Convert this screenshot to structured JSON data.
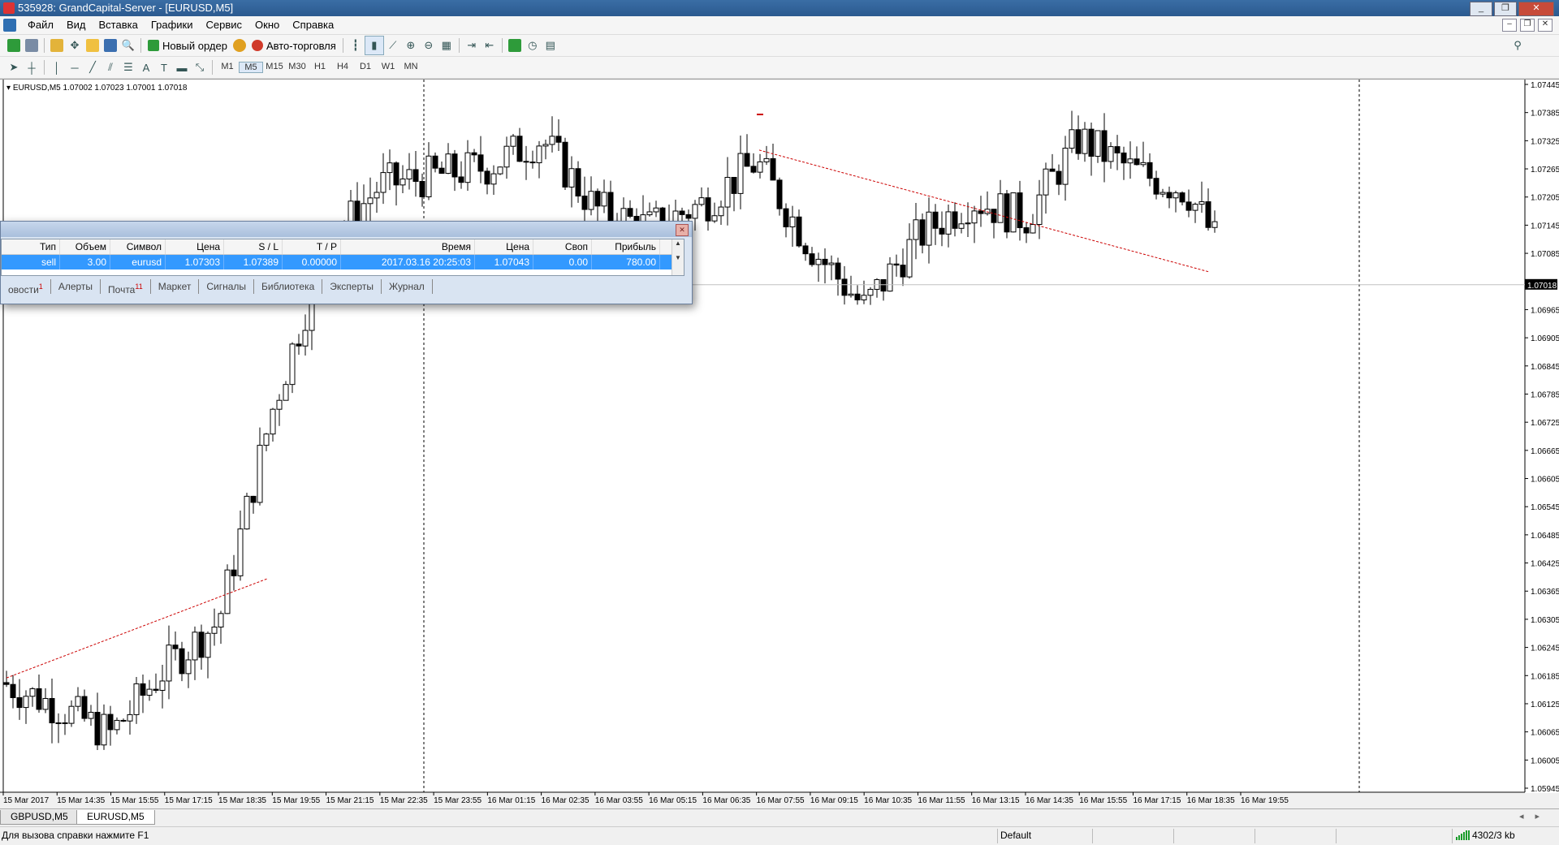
{
  "window": {
    "title": "535928: GrandCapital-Server - [EURUSD,M5]"
  },
  "menu": {
    "items": [
      "Файл",
      "Вид",
      "Вставка",
      "Графики",
      "Сервис",
      "Окно",
      "Справка"
    ]
  },
  "toolbar": {
    "new_order": "Новый ордер",
    "auto_trading": "Авто-торговля"
  },
  "timeframes": [
    "M1",
    "M5",
    "M15",
    "M30",
    "H1",
    "H4",
    "D1",
    "W1",
    "MN"
  ],
  "chart": {
    "header": "EURUSD,M5  1.07002 1.07023 1.07001 1.07018",
    "current_price": "1.07018",
    "price_labels": [
      "1.07445",
      "1.07385",
      "1.07325",
      "1.07265",
      "1.07205",
      "1.07145",
      "1.07085",
      "1.06965",
      "1.06905",
      "1.06845",
      "1.06785",
      "1.06725",
      "1.06665",
      "1.06605",
      "1.06545",
      "1.06485",
      "1.06425",
      "1.06365",
      "1.06305",
      "1.06245",
      "1.06185",
      "1.06125",
      "1.06065",
      "1.06005",
      "1.05945"
    ],
    "time_labels": [
      "15 Mar 2017",
      "15 Mar 14:35",
      "15 Mar 15:55",
      "15 Mar 17:15",
      "15 Mar 18:35",
      "15 Mar 19:55",
      "15 Mar 21:15",
      "15 Mar 22:35",
      "15 Mar 23:55",
      "16 Mar 01:15",
      "16 Mar 02:35",
      "16 Mar 03:55",
      "16 Mar 05:15",
      "16 Mar 06:35",
      "16 Mar 07:55",
      "16 Mar 09:15",
      "16 Mar 10:35",
      "16 Mar 11:55",
      "16 Mar 13:15",
      "16 Mar 14:35",
      "16 Mar 15:55",
      "16 Mar 17:15",
      "16 Mar 18:35",
      "16 Mar 19:55"
    ]
  },
  "chart_data": {
    "type": "candlestick",
    "symbol": "EURUSD",
    "timeframe": "M5",
    "ylim": [
      1.05945,
      1.07445
    ],
    "last": {
      "open": 1.07002,
      "high": 1.07023,
      "low": 1.07001,
      "close": 1.07018
    },
    "close_path": [
      [
        "15 Mar 2017",
        1.0617
      ],
      [
        "15 Mar 14:35",
        1.0612
      ],
      [
        "15 Mar 15:55",
        1.0606
      ],
      [
        "15 Mar 17:15",
        1.062
      ],
      [
        "15 Mar 18:35",
        1.063
      ],
      [
        "15 Mar 19:55",
        1.0675
      ],
      [
        "15 Mar 21:15",
        1.071
      ],
      [
        "15 Mar 22:35",
        1.0723
      ],
      [
        "15 Mar 23:55",
        1.0725
      ],
      [
        "16 Mar 01:15",
        1.0727
      ],
      [
        "16 Mar 02:35",
        1.0733
      ],
      [
        "16 Mar 03:55",
        1.0718
      ],
      [
        "16 Mar 05:15",
        1.0714
      ],
      [
        "16 Mar 06:35",
        1.0719
      ],
      [
        "16 Mar 07:55",
        1.0728
      ],
      [
        "16 Mar 09:15",
        1.071
      ],
      [
        "16 Mar 10:35",
        1.0697
      ],
      [
        "16 Mar 11:55",
        1.0712
      ],
      [
        "16 Mar 13:15",
        1.072
      ],
      [
        "16 Mar 14:35",
        1.0716
      ],
      [
        "16 Mar 15:55",
        1.0733
      ],
      [
        "16 Mar 17:15",
        1.0726
      ],
      [
        "16 Mar 18:35",
        1.0722
      ],
      [
        "16 Mar 19:55",
        1.07018
      ]
    ]
  },
  "terminal": {
    "headers": [
      "Тип",
      "Объем",
      "Символ",
      "Цена",
      "S / L",
      "T / P",
      "Время",
      "Цена",
      "Своп",
      "Прибыль"
    ],
    "row": [
      "sell",
      "3.00",
      "eurusd",
      "1.07303",
      "1.07389",
      "0.00000",
      "2017.03.16 20:25:03",
      "1.07043",
      "0.00",
      "780.00"
    ],
    "tabs": [
      {
        "label": "овости",
        "badge": "1"
      },
      {
        "label": "Алерты",
        "badge": ""
      },
      {
        "label": "Почта",
        "badge": "11"
      },
      {
        "label": "Маркет",
        "badge": ""
      },
      {
        "label": "Сигналы",
        "badge": ""
      },
      {
        "label": "Библиотека",
        "badge": ""
      },
      {
        "label": "Эксперты",
        "badge": ""
      },
      {
        "label": "Журнал",
        "badge": ""
      }
    ]
  },
  "chart_tabs": [
    "GBPUSD,M5",
    "EURUSD,M5"
  ],
  "status": {
    "help": "Для вызова справки нажмите F1",
    "profile": "Default",
    "connection": "4302/3 kb"
  },
  "colors": {
    "selection": "#3399ff",
    "trendline": "#cc0000",
    "candle": "#000000",
    "title_bar": "#2b5a8f"
  }
}
